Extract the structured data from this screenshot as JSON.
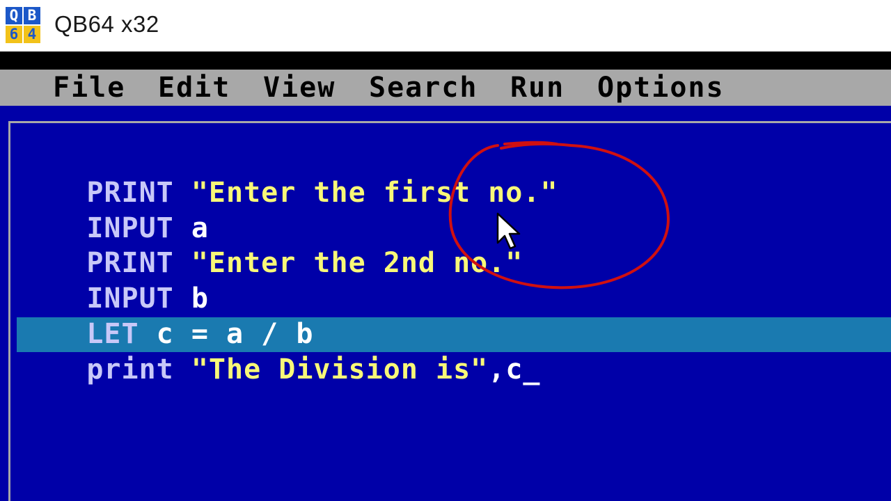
{
  "window": {
    "title": "QB64 x32",
    "logo": {
      "q": "Q",
      "b": "B",
      "six": "6",
      "four": "4"
    }
  },
  "menubar": {
    "items": [
      "File",
      "Edit",
      "View",
      "Search",
      "Run",
      "Options"
    ]
  },
  "editor": {
    "lines": [
      {
        "keyword": "PRINT",
        "rest": " \"Enter the first no.\""
      },
      {
        "keyword": "INPUT",
        "rest": " a"
      },
      {
        "keyword": "PRINT",
        "rest": " \"Enter the 2nd no.\""
      },
      {
        "keyword": "INPUT",
        "rest": " b"
      },
      {
        "keyword": "LET",
        "rest": " c = a / b"
      },
      {
        "keyword": "print",
        "string": " \"The Division is\"",
        "tail": ",c",
        "cursor": "_"
      }
    ]
  },
  "colors": {
    "editor_background": "#0000a8",
    "menubar_background": "#a8a8a8",
    "keyword": "#c8c8f8",
    "string": "#f8f878",
    "identifier": "#ffffff",
    "current_line": "#1a7ab0",
    "annotation": "#d01010"
  },
  "icons": {
    "app_logo": "qb64-logo-icon",
    "pointer": "mouse-pointer-icon"
  }
}
